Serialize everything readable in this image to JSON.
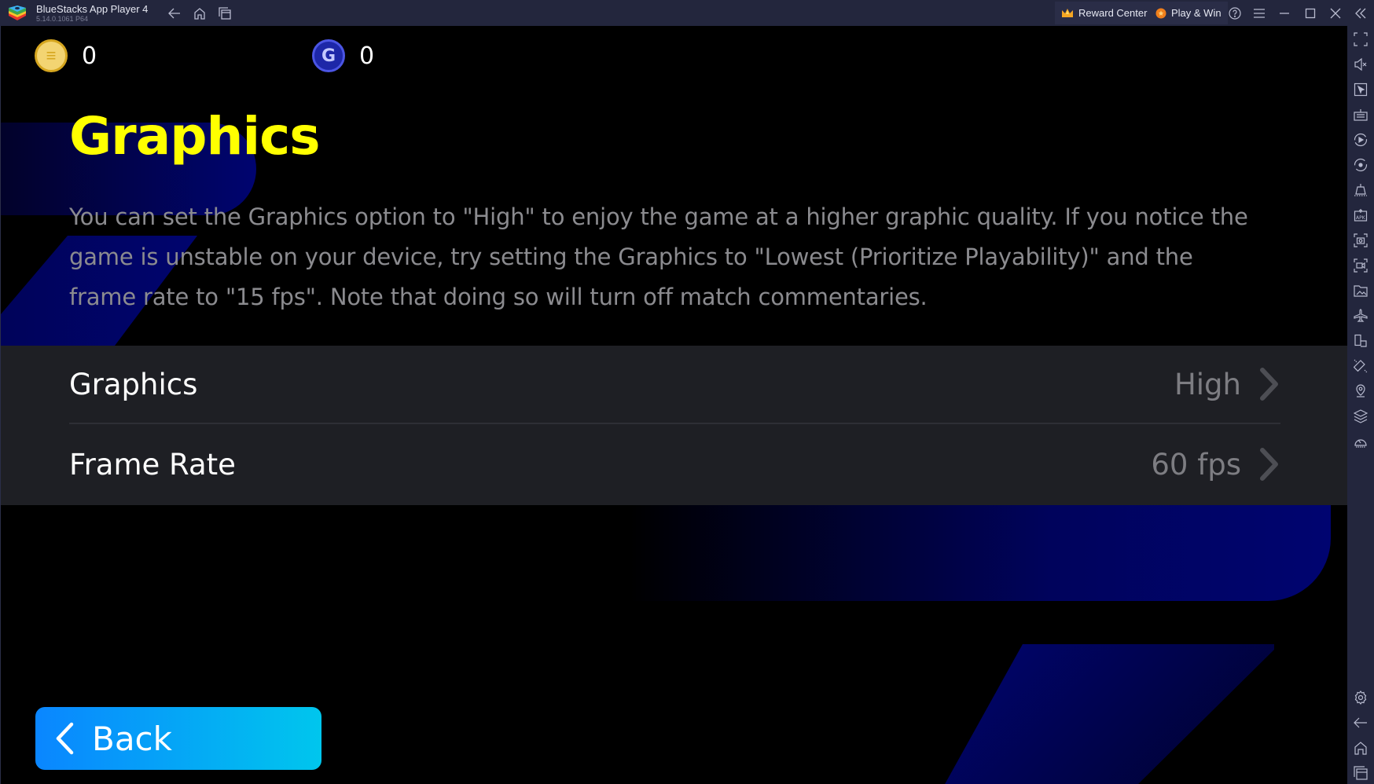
{
  "titlebar": {
    "app_name": "BlueStacks App Player 4",
    "app_version": "5.14.0.1061  P64",
    "reward_center_label": "Reward Center",
    "play_win_label": "Play & Win"
  },
  "game": {
    "currencies": [
      {
        "name": "efootball-coin",
        "value": "0",
        "glyph": "≡"
      },
      {
        "name": "gp",
        "value": "0",
        "glyph": "G"
      }
    ],
    "page_title": "Graphics",
    "description": "You can set the Graphics option to \"High\" to enjoy the game at a higher graphic quality. If you notice the game is unstable on your device, try setting the Graphics to \"Lowest (Prioritize Playability)\" and the frame rate to \"15 fps\". Note that doing so will turn off match commentaries.",
    "settings": [
      {
        "label": "Graphics",
        "value": "High"
      },
      {
        "label": "Frame Rate",
        "value": "60 fps"
      }
    ],
    "back_label": "Back",
    "colors": {
      "title": "#ffff00",
      "accent_blue": "#000470",
      "back_gradient_start": "#0a86ff",
      "back_gradient_end": "#00c6ed"
    }
  },
  "sidebar": {
    "tools": [
      "collapse-sidebar",
      "fullscreen",
      "volume-mute",
      "pointer-lock",
      "keyboard-controls",
      "macro-recorder",
      "sync-operations",
      "game-controls",
      "install-apk",
      "screenshot",
      "record-screen",
      "media-manager",
      "airplane-mode",
      "multi-instance",
      "rotate",
      "location",
      "layers",
      "performance",
      "settings",
      "back",
      "home",
      "recent-apps"
    ]
  }
}
